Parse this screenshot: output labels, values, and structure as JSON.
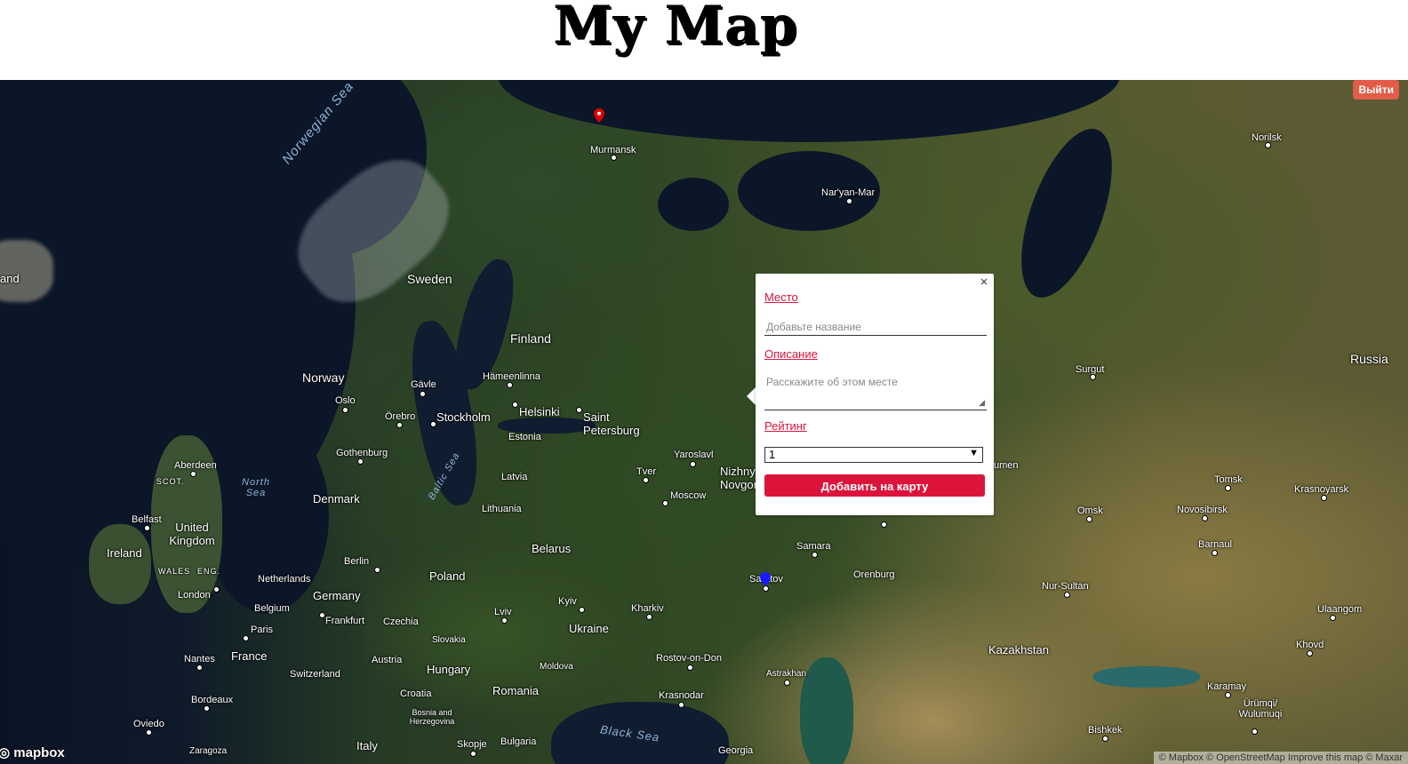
{
  "header": {
    "title": "My Map"
  },
  "auth": {
    "logout_label": "Выйти"
  },
  "map": {
    "labels": {
      "norwegian_sea": "Norwegian Sea",
      "north_sea": "North Sea",
      "baltic_sea": "Baltic Sea",
      "black_sea": "Black Sea",
      "iceland": "and",
      "sweden": "Sweden",
      "finland": "Finland",
      "norway": "Norway",
      "russia": "Russia",
      "murmansk": "Murmansk",
      "naryan_mar": "Nar'yan-Mar",
      "norilsk": "Norilsk",
      "surgut": "Surgut",
      "hameenlinna": "Hämeenlinna",
      "gavle": "Gävle",
      "oslo": "Oslo",
      "orebro": "Örebro",
      "stockholm": "Stockholm",
      "helsinki": "Helsinki",
      "saint_petersburg": "Saint Petersburg",
      "estonia": "Estonia",
      "gothenburg": "Gothenburg",
      "yaroslavl": "Yaroslavl",
      "nizhny": "Nizhny Novgorod",
      "tver": "Tver",
      "aberdeen": "Aberdeen",
      "scot": "SCOT.",
      "latvia": "Latvia",
      "moscow": "Moscow",
      "tyumen": "umen",
      "tomsk": "Tomsk",
      "krasnoyarsk": "Krasnoyarsk",
      "denmark": "Denmark",
      "lithuania": "Lithuania",
      "omsk": "Omsk",
      "novosibirsk": "Novosibirsk",
      "belfast": "Belfast",
      "united_kingdom": "United Kingdom",
      "ireland": "Ireland",
      "wales": "WALES",
      "eng": "ENG.",
      "london": "London",
      "netherlands": "Netherlands",
      "berlin": "Berlin",
      "poland": "Poland",
      "belarus": "Belarus",
      "samara": "Samara",
      "barnaul": "Barnaul",
      "germany": "Germany",
      "saratov": "Saratov",
      "orenburg": "Orenburg",
      "nur_sultan": "Nur-Sultan",
      "belgium": "Belgium",
      "frankfurt": "Frankfurt",
      "czechia": "Czechia",
      "kyiv": "Kyiv",
      "kharkiv": "Kharkiv",
      "lviv": "Lviv",
      "ulaangom": "Ulaangom",
      "paris": "Paris",
      "ukraine": "Ukraine",
      "slovakia": "Slovakia",
      "khovd": "Khovd",
      "nantes": "Nantes",
      "france": "France",
      "austria": "Austria",
      "hungary": "Hungary",
      "rostov": "Rostov-on-Don",
      "kazakhstan": "Kazakhstan",
      "switzerland": "Switzerland",
      "moldova": "Moldova",
      "astrakhan": "Astrakhan",
      "croatia": "Croatia",
      "romania": "Romania",
      "karamay": "Karamay",
      "bordeaux": "Bordeaux",
      "krasnodar": "Krasnodar",
      "urumqi": "Ürümqi/ Wulumuqi",
      "bosnia": "Bosnia and Herzegovina",
      "oviedo": "Oviedo",
      "bishkek": "Bishkek",
      "italy": "Italy",
      "skopje": "Skopje",
      "bulgaria": "Bulgaria",
      "zaragoza": "Zaragoza",
      "georgia": "Georgia"
    },
    "logo": "mapbox",
    "attribution": "© Mapbox © OpenStreetMap Improve this map © Maxar"
  },
  "popup": {
    "close": "×",
    "place_label": "Место",
    "place_placeholder": "Добавьте название",
    "description_label": "Описание",
    "description_placeholder": "Расскажите об этом месте",
    "rating_label": "Рейтинг",
    "rating_value": "1",
    "submit_label": "Добавить на карту"
  },
  "colors": {
    "accent": "#dc143c",
    "logout": "#e25d48",
    "marker_red": "#e00000",
    "marker_blue": "#1a1aff"
  }
}
